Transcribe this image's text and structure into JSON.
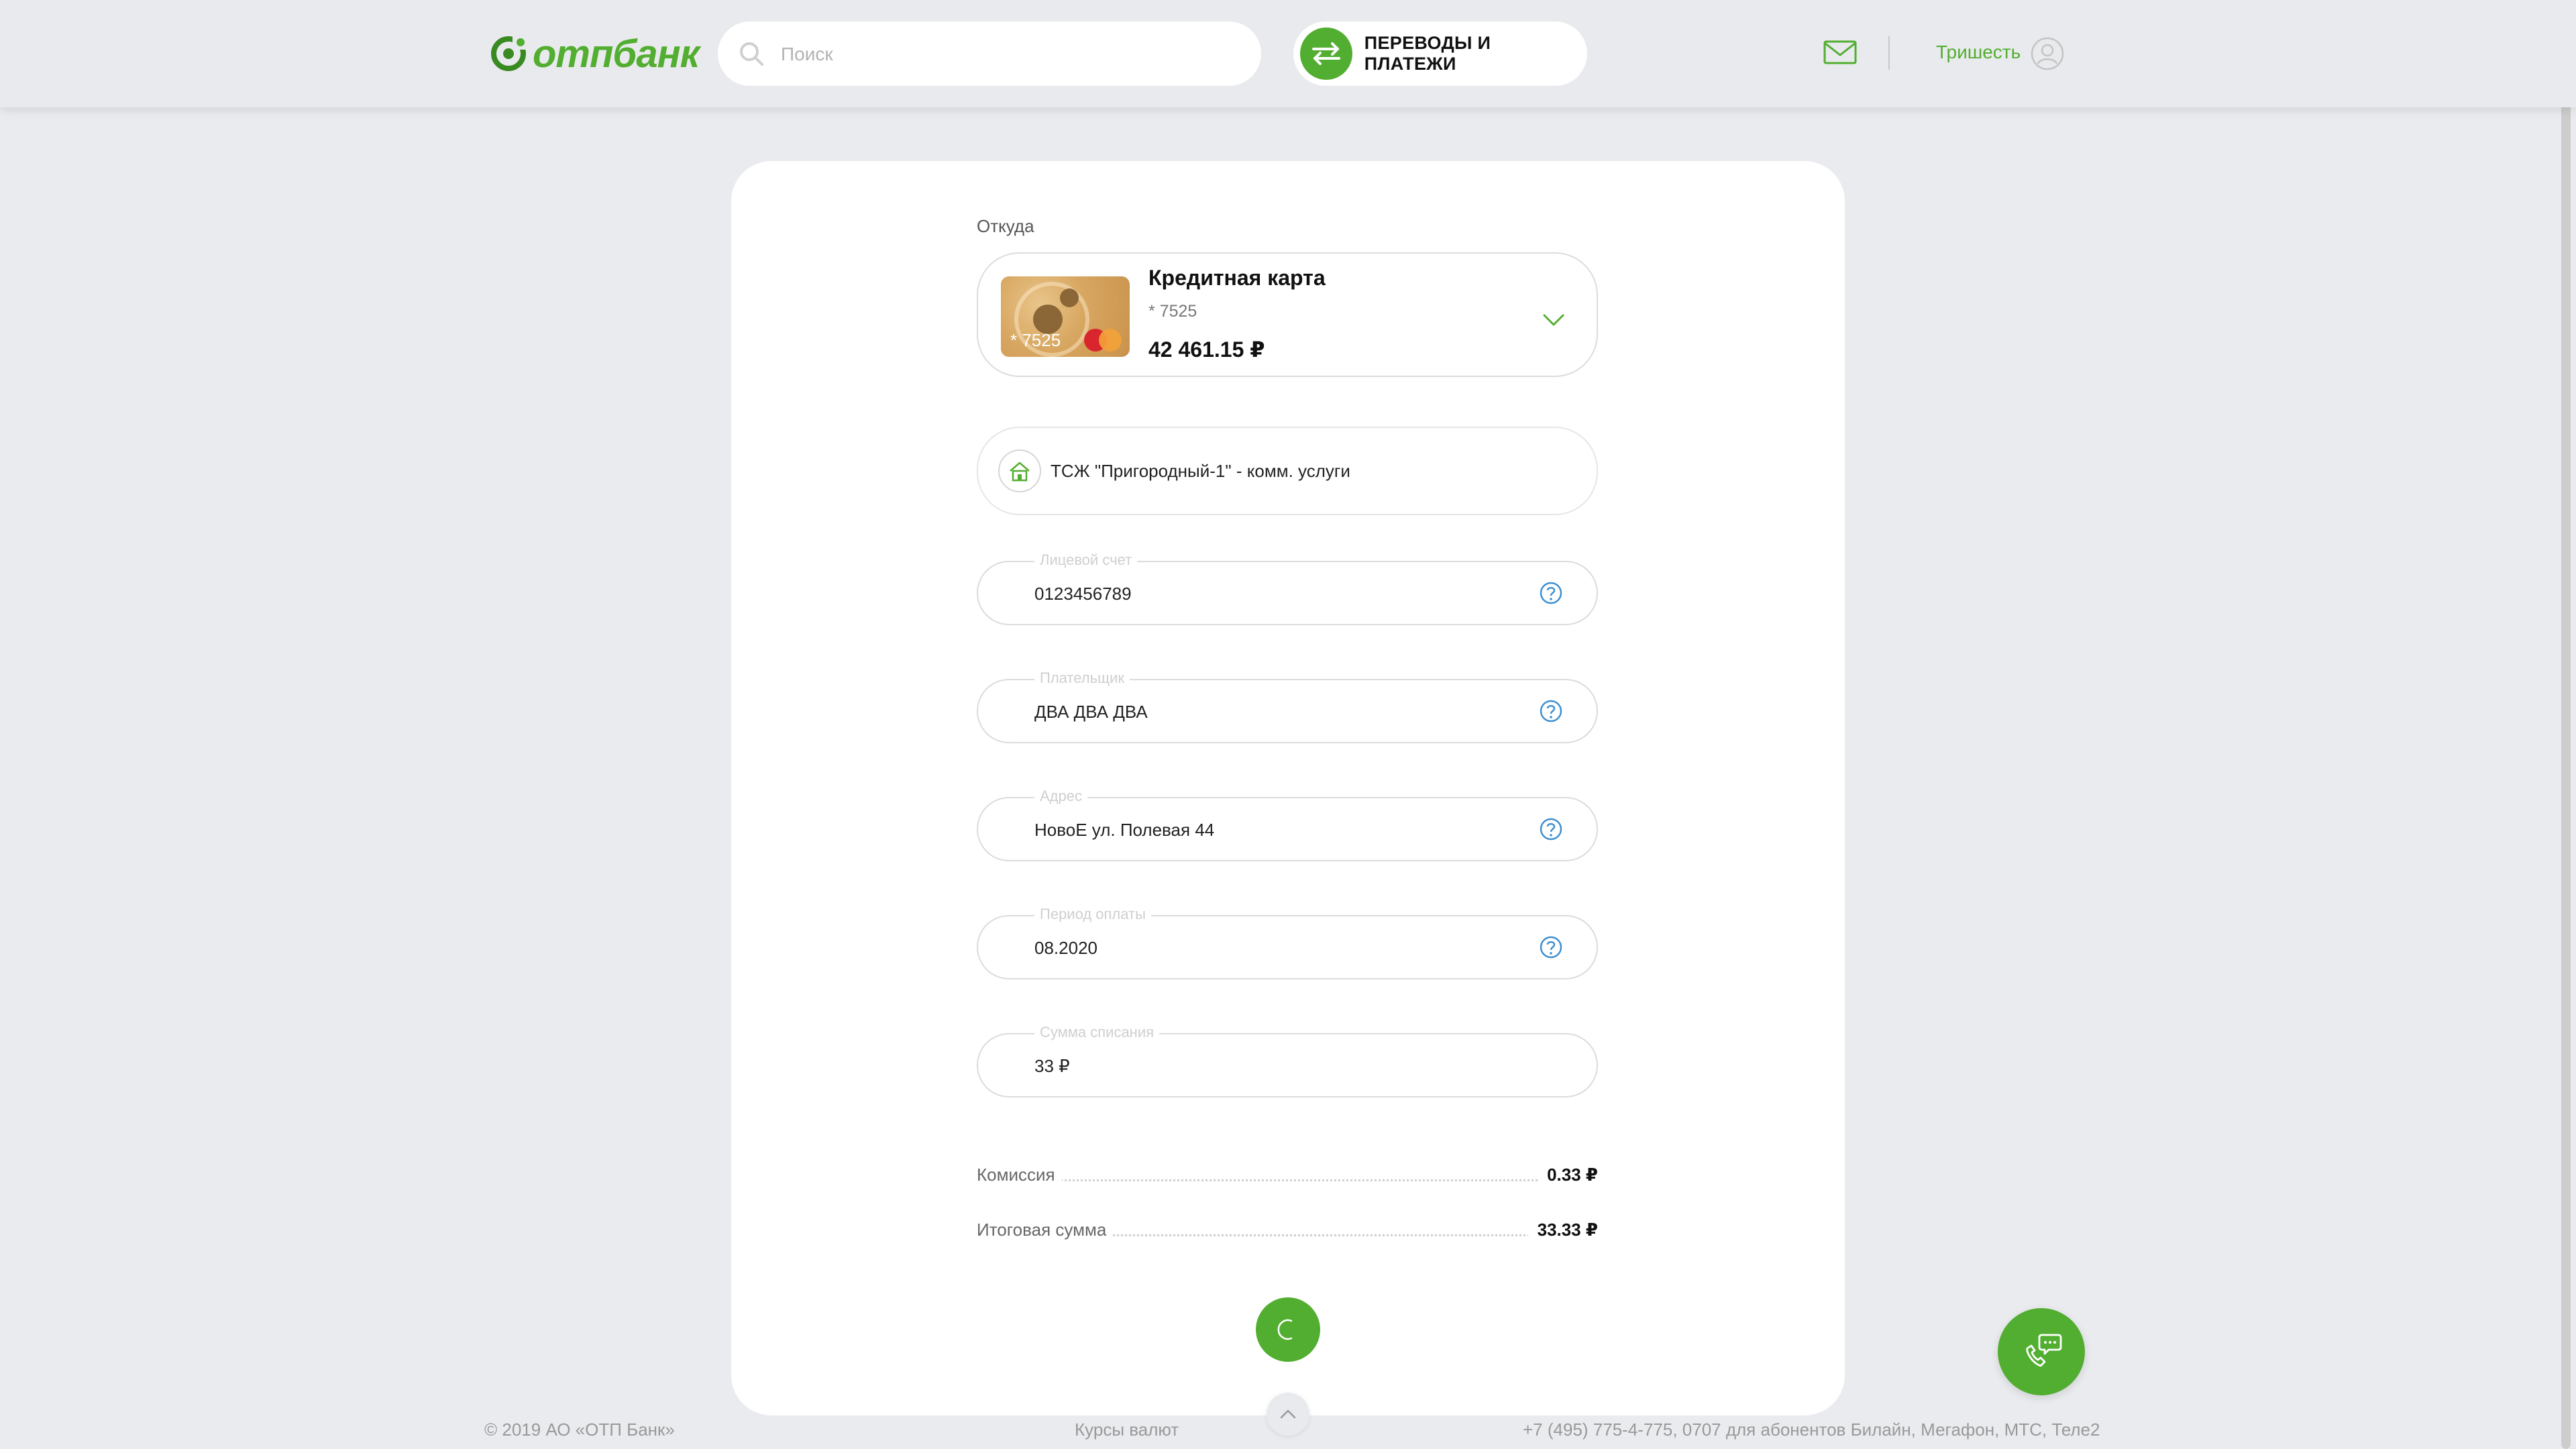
{
  "header": {
    "logo_text": "отпбанк",
    "search_placeholder": "Поиск",
    "transfers_label": "ПЕРЕВОДЫ И ПЛАТЕЖИ",
    "user_name": "Тришесть"
  },
  "payment": {
    "from_label": "Откуда",
    "account": {
      "card_number_short": "* 7525",
      "title": "Кредитная карта",
      "mask": "* 7525",
      "balance": "42 461.15 ₽"
    },
    "recipient_name": "ТСЖ \"Пригородный-1\" - комм. услуги",
    "fields": [
      {
        "label": "Лицевой счет",
        "value": "0123456789"
      },
      {
        "label": "Плательщик",
        "value": "ДВА ДВА ДВА"
      },
      {
        "label": "Адрес",
        "value": "НовоЕ ул. Полевая 44"
      },
      {
        "label": "Период оплаты",
        "value": "08.2020"
      },
      {
        "label": "Сумма списания",
        "value": "33 ₽"
      }
    ],
    "commission_label": "Комиссия",
    "commission_value": "0.33 ₽",
    "total_label": "Итоговая сумма",
    "total_value": "33.33 ₽"
  },
  "footer": {
    "copyright": "© 2019 АО «ОТП Банк»",
    "rates_link": "Курсы валют",
    "phones": "+7 (495) 775-4-775,   0707 для абонентов Билайн, Мегафон, МТС, Теле2"
  },
  "colors": {
    "accent": "#52ae30",
    "background": "#eaebee"
  }
}
